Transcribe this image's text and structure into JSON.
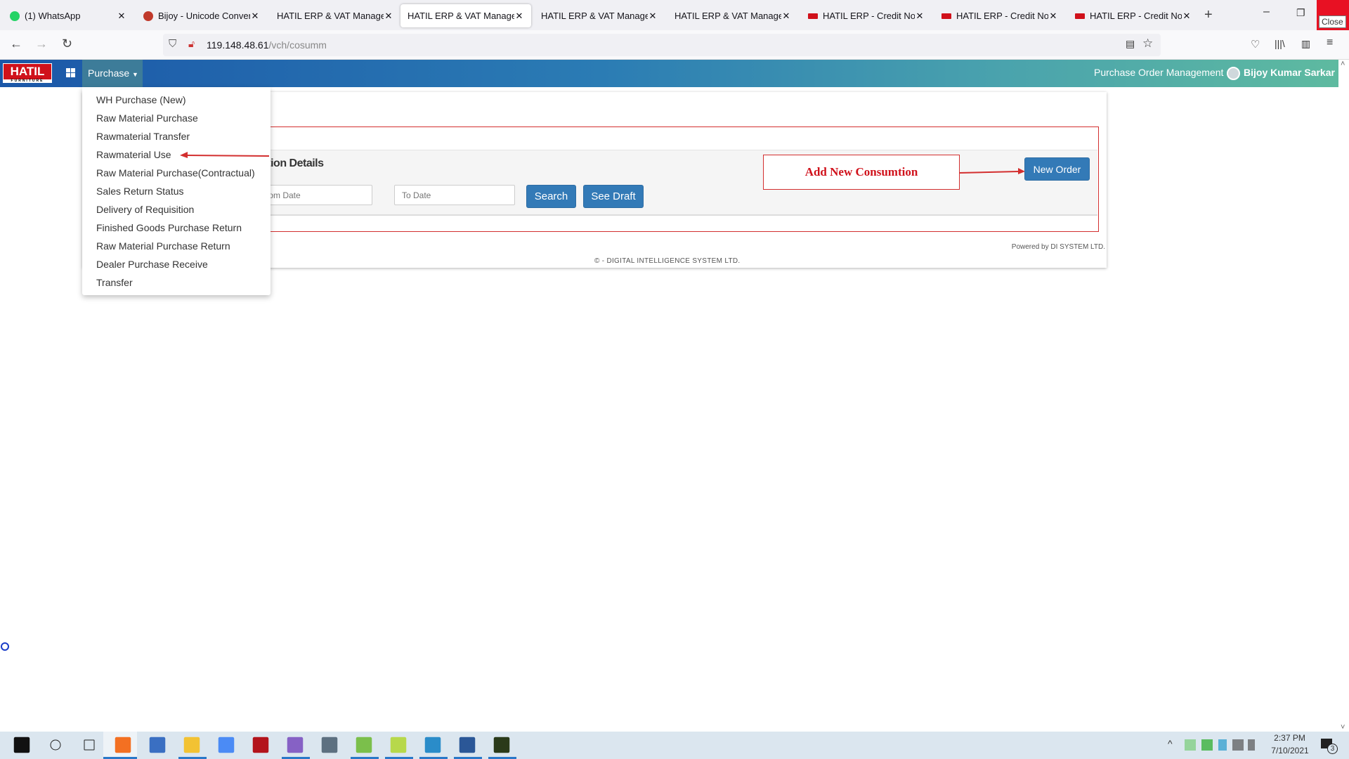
{
  "browser": {
    "tabs": [
      {
        "label": "(1) WhatsApp",
        "icon": "whatsapp-icon"
      },
      {
        "label": "Bijoy - Unicode Converte",
        "icon": "bijoy-icon"
      },
      {
        "label": "HATIL ERP & VAT Manageme"
      },
      {
        "label": "HATIL ERP & VAT Manageme",
        "active": true
      },
      {
        "label": "HATIL ERP & VAT Manageme"
      },
      {
        "label": "HATIL ERP & VAT Manageme"
      },
      {
        "label": "HATIL ERP - Credit Note (",
        "icon": "hatil-icon"
      },
      {
        "label": "HATIL ERP - Credit Note (",
        "icon": "hatil-icon"
      },
      {
        "label": "HATIL ERP - Credit Note (",
        "icon": "hatil-icon"
      }
    ],
    "close_tooltip": "Close",
    "url_host": "119.148.48.61",
    "url_path": "/vch/cosumm"
  },
  "app": {
    "logo": "HATIL",
    "logo_sub": "FURNITURE",
    "menu_label": "Purchase",
    "module_title": "Purchase Order Management",
    "user": "Bijoy Kumar Sarkar",
    "brand_color": "#1b57a8"
  },
  "dropdown": {
    "items": [
      "WH Purchase (New)",
      "Raw Material Purchase",
      "Rawmaterial Transfer",
      "Rawmaterial Use",
      "Raw Material Purchase(Contractual)",
      "Sales Return Status",
      "Delivery of Requisition",
      "Finished Goods Purchase Return",
      "Raw Material Purchase Return",
      "Dealer Purchase Receive",
      "Transfer"
    ]
  },
  "page": {
    "title": "Consumption Details",
    "from_placeholder": "From Date",
    "to_placeholder": "To Date",
    "search": "Search",
    "see_draft": "See Draft",
    "new_order": "New Order",
    "annotation": "Add New Consumtion",
    "powered": "Powered by DI SYSTEM LTD.",
    "copyright": "© - DIGITAL INTELLIGENCE SYSTEM LTD."
  },
  "taskbar": {
    "time": "2:37 PM",
    "date": "7/10/2021",
    "notifications": "3"
  }
}
